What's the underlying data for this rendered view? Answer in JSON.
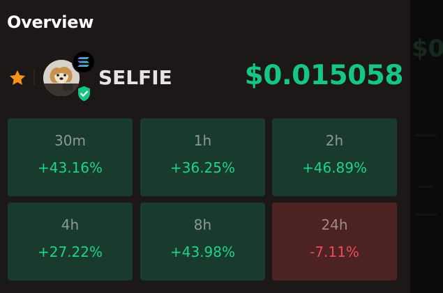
{
  "overview": {
    "title": "Overview"
  },
  "token": {
    "symbol": "SELFIE",
    "price": "$0.015058",
    "is_favorite": true,
    "verified": true,
    "chain_icon": "solana-icon",
    "avatar_icon": "dog-avatar-icon"
  },
  "periods": [
    {
      "label": "30m",
      "change": "+43.16%",
      "trend": "up"
    },
    {
      "label": "1h",
      "change": "+36.25%",
      "trend": "up"
    },
    {
      "label": "2h",
      "change": "+46.89%",
      "trend": "up"
    },
    {
      "label": "4h",
      "change": "+27.22%",
      "trend": "up"
    },
    {
      "label": "8h",
      "change": "+43.98%",
      "trend": "up"
    },
    {
      "label": "24h",
      "change": "-7.11%",
      "trend": "down"
    }
  ],
  "colors": {
    "positive": "#1ed38a",
    "negative": "#f04a55",
    "price": "#16c784",
    "favorite_star": "#f7931a",
    "verified": "#16c784"
  }
}
